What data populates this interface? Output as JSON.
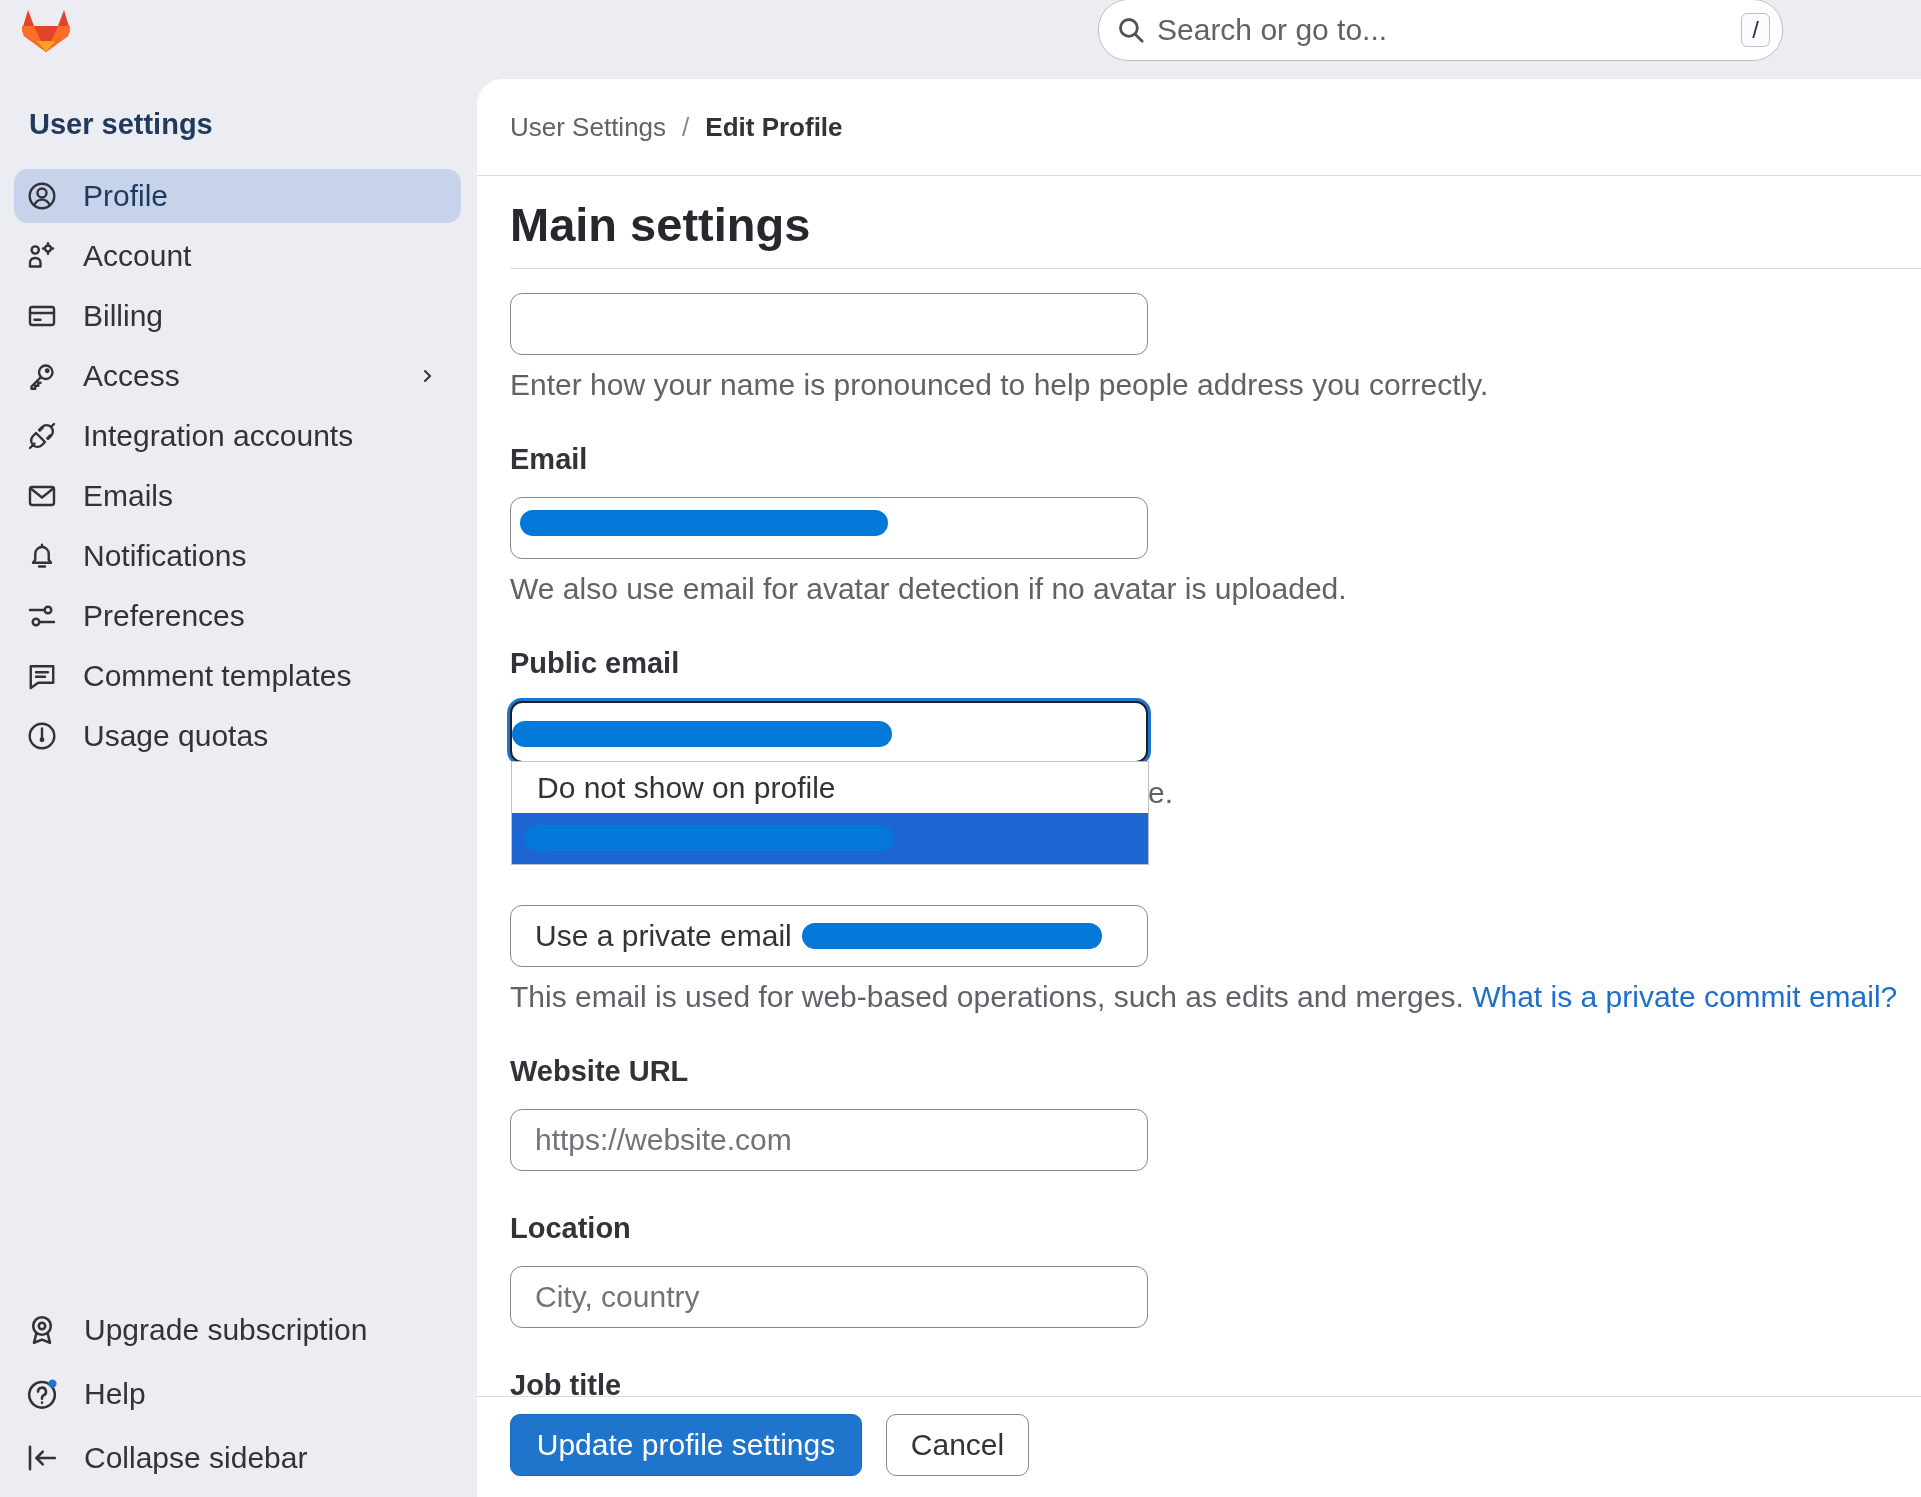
{
  "search": {
    "placeholder": "Search or go to...",
    "shortcut": "/"
  },
  "sidebar": {
    "title": "User settings",
    "items": [
      {
        "label": "Profile",
        "selected": true,
        "has_submenu": false
      },
      {
        "label": "Account",
        "selected": false,
        "has_submenu": false
      },
      {
        "label": "Billing",
        "selected": false,
        "has_submenu": false
      },
      {
        "label": "Access",
        "selected": false,
        "has_submenu": true
      },
      {
        "label": "Integration accounts",
        "selected": false,
        "has_submenu": false
      },
      {
        "label": "Emails",
        "selected": false,
        "has_submenu": false
      },
      {
        "label": "Notifications",
        "selected": false,
        "has_submenu": false
      },
      {
        "label": "Preferences",
        "selected": false,
        "has_submenu": false
      },
      {
        "label": "Comment templates",
        "selected": false,
        "has_submenu": false
      },
      {
        "label": "Usage quotas",
        "selected": false,
        "has_submenu": false
      }
    ],
    "footer_items": [
      {
        "label": "Upgrade subscription"
      },
      {
        "label": "Help"
      },
      {
        "label": "Collapse sidebar"
      }
    ]
  },
  "breadcrumb": {
    "separator": "/",
    "items": [
      {
        "label": "User Settings",
        "current": false
      },
      {
        "label": "Edit Profile",
        "current": true
      }
    ]
  },
  "heading": "Main settings",
  "fields": [
    {
      "kind": "input",
      "help": "Enter how your name is pronounced to help people address you correctly."
    },
    {
      "kind": "input",
      "label": "Email",
      "redacted": true,
      "help": "We also use email for avatar detection if no avatar is uploaded."
    },
    {
      "kind": "select",
      "label": "Public email",
      "redacted": true,
      "focused": true,
      "open": true,
      "options": [
        {
          "label": "Do not show on profile",
          "selected": false,
          "redacted": false
        },
        {
          "selected": true,
          "redacted": true
        }
      ],
      "help": "e."
    },
    {
      "kind": "select",
      "value": "Use a private email",
      "redacted": true,
      "focused": false,
      "open": false,
      "help": "This email is used for web-based operations, such as edits and merges.",
      "help_link": "What is a private commit email?"
    },
    {
      "kind": "input",
      "label": "Website URL",
      "placeholder": "https://website.com"
    },
    {
      "kind": "input",
      "label": "Location",
      "placeholder": "City, country"
    },
    {
      "kind": "label",
      "label": "Job title"
    }
  ],
  "actions": [
    {
      "label": "Update profile settings",
      "kind": "primary"
    },
    {
      "label": "Cancel",
      "kind": "secondary"
    }
  ]
}
